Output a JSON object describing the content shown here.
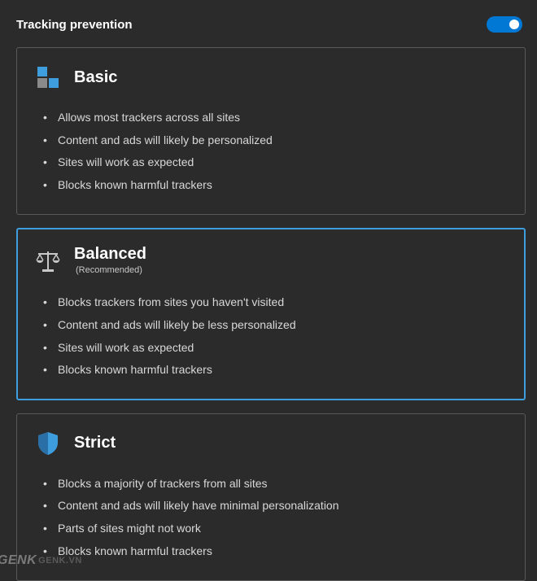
{
  "header": {
    "title": "Tracking prevention",
    "toggle_on": true
  },
  "cards": {
    "basic": {
      "title": "Basic",
      "features": [
        "Allows most trackers across all sites",
        "Content and ads will likely be personalized",
        "Sites will work as expected",
        "Blocks known harmful trackers"
      ]
    },
    "balanced": {
      "title": "Balanced",
      "subtitle": "(Recommended)",
      "features": [
        "Blocks trackers from sites you haven't visited",
        "Content and ads will likely be less personalized",
        "Sites will work as expected",
        "Blocks known harmful trackers"
      ]
    },
    "strict": {
      "title": "Strict",
      "features": [
        "Blocks a majority of trackers from all sites",
        "Content and ads will likely have minimal personalization",
        "Parts of sites might not work",
        "Blocks known harmful trackers"
      ]
    }
  },
  "watermark": {
    "part1": "/GENK",
    "part2": "GENK.VN"
  },
  "colors": {
    "accent": "#0078d4",
    "selected_border": "#3e9ddd"
  }
}
